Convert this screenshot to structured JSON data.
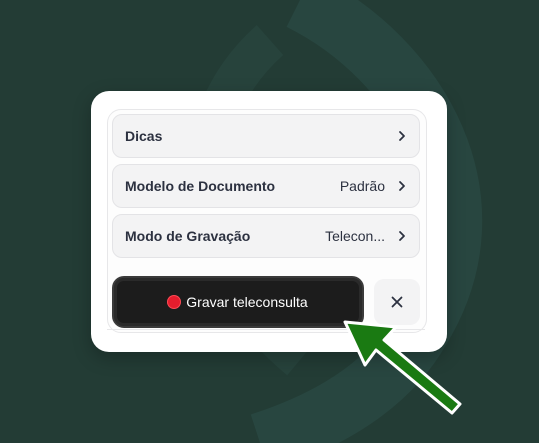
{
  "menu": {
    "items": [
      {
        "label": "Dicas",
        "value": ""
      },
      {
        "label": "Modelo de Documento",
        "value": "Padrão"
      },
      {
        "label": "Modo de Gravação",
        "value": "Telecon..."
      }
    ]
  },
  "record_button": {
    "label": "Gravar teleconsulta"
  },
  "icons": {
    "record": "record-dot-icon",
    "close": "close-icon",
    "chevron": "chevron-right-icon"
  },
  "colors": {
    "background": "#233c35",
    "record": "#e51d2d",
    "arrow": "#1a7a12"
  }
}
